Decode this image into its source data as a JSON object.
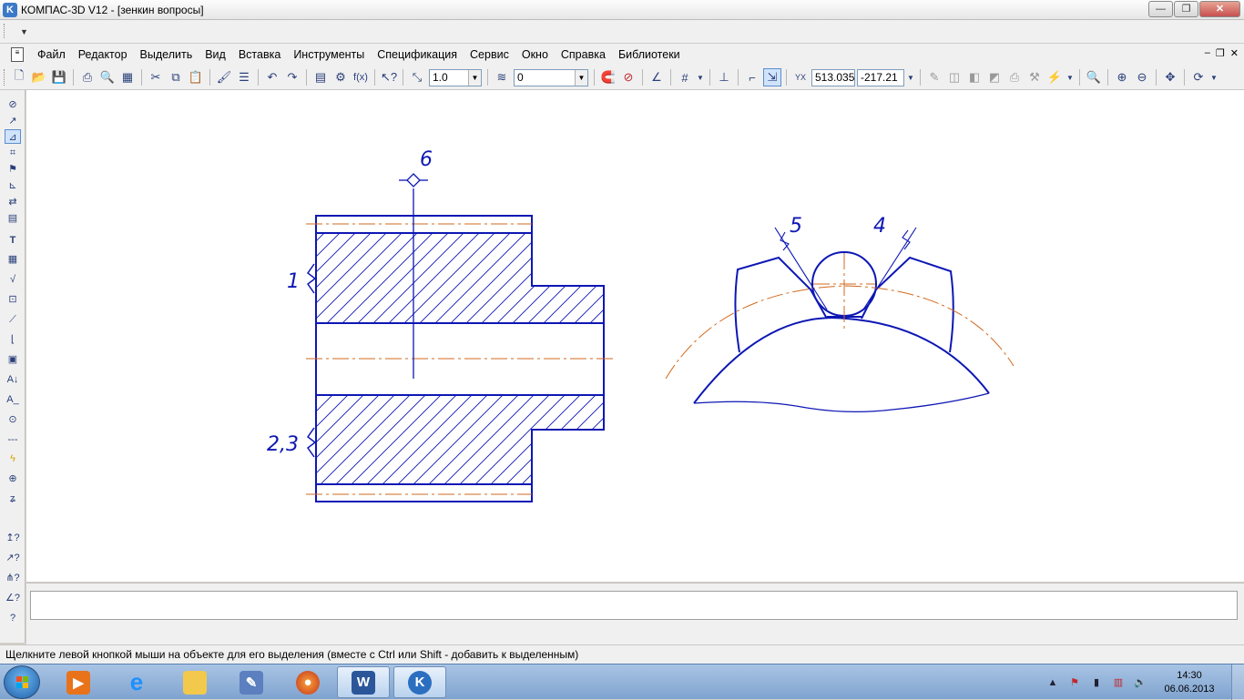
{
  "window": {
    "title": "КОМПАС-3D V12 - [зенкин вопросы]",
    "logo": "K",
    "minimize_glyph": "—",
    "maximize_glyph": "❐",
    "close_glyph": "✕"
  },
  "menu": {
    "items": [
      "Файл",
      "Редактор",
      "Выделить",
      "Вид",
      "Вставка",
      "Инструменты",
      "Спецификация",
      "Сервис",
      "Окно",
      "Справка",
      "Библиотеки"
    ],
    "mdi_minimize": "–",
    "mdi_restore": "❐",
    "mdi_close": "✕"
  },
  "toolbar": {
    "scale_value": "1.0",
    "layer_value": "0",
    "fx_label": "f(x)",
    "coord_x": "513.035",
    "coord_y": "-217.21"
  },
  "drawing": {
    "labels": {
      "callout_6": "6",
      "callout_1": "1",
      "callout_23": "2,3",
      "callout_5": "5",
      "callout_4": "4"
    },
    "colors": {
      "contour": "#0d17b4",
      "axis": "#d2691e",
      "hatch": "#0d17b4"
    }
  },
  "status": {
    "hint": "Щелкните левой кнопкой мыши на объекте для его выделения (вместе с Ctrl или Shift - добавить к выделенным)"
  },
  "taskbar": {
    "word_letter": "W",
    "kompas_letter": "K",
    "time": "14:30",
    "date": "06.06.2013",
    "tray_arrow": "▲"
  }
}
